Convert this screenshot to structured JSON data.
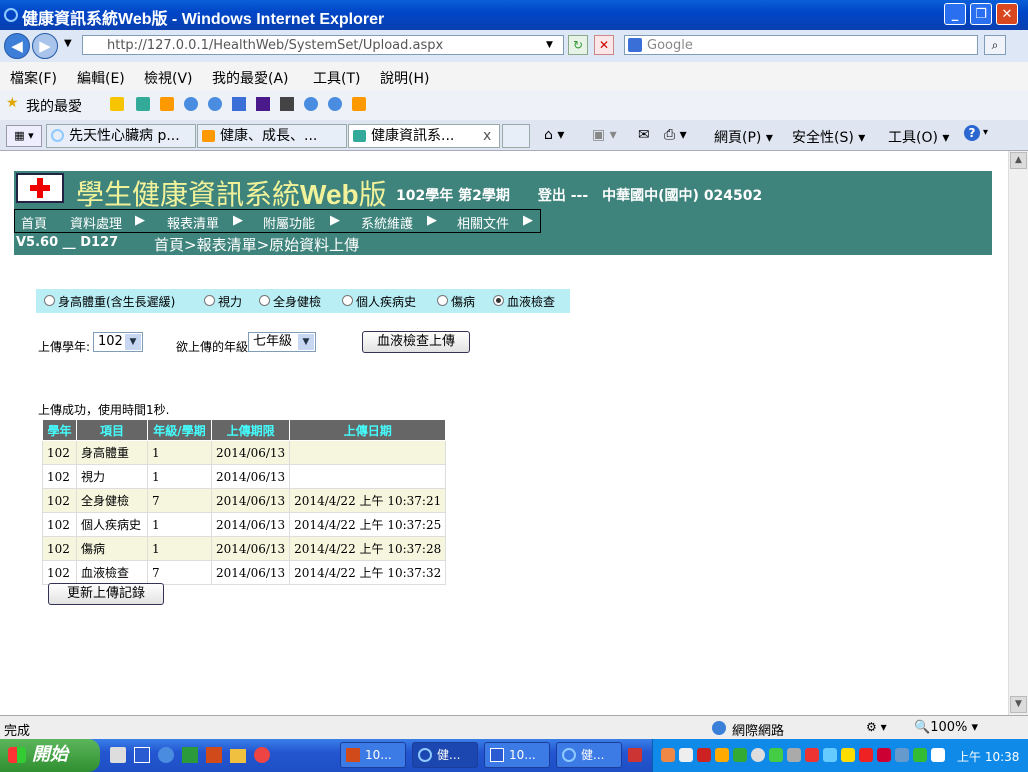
{
  "window": {
    "title": "健康資訊系統Web版 - Windows Internet Explorer",
    "minimize": "_",
    "restore": "❐",
    "close": "✕"
  },
  "address": {
    "url": "http://127.0.0.1/HealthWeb/SystemSet/Upload.aspx",
    "search_placeholder": "Google"
  },
  "menu": [
    "檔案(F)",
    "編輯(E)",
    "檢視(V)",
    "我的最愛(A)",
    "工具(T)",
    "說明(H)"
  ],
  "favorites": {
    "label": "我的最愛"
  },
  "tabs": [
    {
      "label": "先天性心臟病 p..."
    },
    {
      "label": "健康、成長、..."
    },
    {
      "label": "健康資訊系..."
    }
  ],
  "tab_close": "x",
  "toolbar": {
    "page": "網頁(P)",
    "safety": "安全性(S)",
    "tools": "工具(O)"
  },
  "app": {
    "title_cn": "學生健康資訊系統",
    "title_web": "Web",
    "title_ban": "版",
    "info": "102學年 第2學期　　登出 ---　中華國中(國中) 024502",
    "menu": [
      "首頁",
      "資料處理",
      "報表清單",
      "附屬功能",
      "系統維護",
      "相關文件"
    ],
    "version": "V5.60 __ D127",
    "breadcrumb": "首頁>報表清單>原始資料上傳"
  },
  "radios": [
    {
      "label": "身高體重(含生長遲緩)",
      "checked": false
    },
    {
      "label": "視力",
      "checked": false
    },
    {
      "label": "全身健檢",
      "checked": false
    },
    {
      "label": "個人疾病史",
      "checked": false
    },
    {
      "label": "傷病",
      "checked": false
    },
    {
      "label": "血液檢查",
      "checked": true
    }
  ],
  "form": {
    "year_label": "上傳學年:",
    "year_value": "102",
    "grade_label": "欲上傳的年級",
    "grade_value": "七年級",
    "upload_button": "血液檢查上傳"
  },
  "result_message": "上傳成功，使用時間1秒.",
  "table": {
    "headers": [
      "學年",
      "項目",
      "年級/學期",
      "上傳期限",
      "上傳日期"
    ],
    "rows": [
      [
        "102",
        "身高體重",
        "1",
        "2014/06/13",
        ""
      ],
      [
        "102",
        "視力",
        "1",
        "2014/06/13",
        ""
      ],
      [
        "102",
        "全身健檢",
        "7",
        "2014/06/13",
        "2014/4/22 上午 10:37:21"
      ],
      [
        "102",
        "個人疾病史",
        "1",
        "2014/06/13",
        "2014/4/22 上午 10:37:25"
      ],
      [
        "102",
        "傷病",
        "1",
        "2014/06/13",
        "2014/4/22 上午 10:37:28"
      ],
      [
        "102",
        "血液檢查",
        "7",
        "2014/06/13",
        "2014/4/22 上午 10:37:32"
      ]
    ]
  },
  "refresh_button": "更新上傳記錄",
  "status": {
    "text": "完成",
    "zone": "網際網路",
    "zoom": "100%"
  },
  "taskbar": {
    "start": "開始",
    "tasks": [
      "10...",
      "健...",
      "10...",
      "健..."
    ],
    "clock": "上午 10:38"
  },
  "colors": {
    "header_bg": "#3f847c",
    "title_yellow": "#f2f29a",
    "radio_bg": "#b9eef5",
    "th_bg": "#666666",
    "th_text": "#44ffff"
  }
}
